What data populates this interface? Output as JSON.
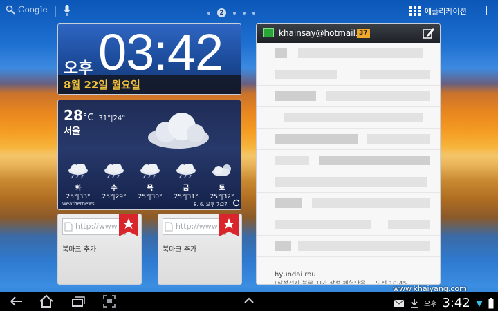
{
  "status_bar": {
    "search_label": "Google",
    "page_indicator": "2",
    "apps_label": "애플리케이션"
  },
  "clock": {
    "ampm": "오후",
    "time": "03:42",
    "date": "8월 22일 월요일"
  },
  "weather": {
    "temp": "28",
    "unit": "°C",
    "high_low": "31°|24°",
    "city": "서울",
    "forecast": [
      {
        "day": "화",
        "temp": "25°|33°"
      },
      {
        "day": "수",
        "temp": "25°|29°"
      },
      {
        "day": "목",
        "temp": "25°|30°"
      },
      {
        "day": "금",
        "temp": "25°|31°"
      },
      {
        "day": "토",
        "temp": "25°|32°"
      }
    ],
    "brand": "weathernews",
    "updated": "8. 6. 오후 7:27"
  },
  "bookmarks": [
    {
      "url": "http://www",
      "label": "북마크 추가"
    },
    {
      "url": "http://www",
      "label": "북마크 추가"
    }
  ],
  "email": {
    "account": "khainsay@hotmail...",
    "unread": "37",
    "last_sender": "hyundai rou",
    "last_preview": "[삼성전자 블로그]가 삼성 체험단을 ... 오전 10:45"
  },
  "system_bar": {
    "ampm": "오후",
    "time": "3:42",
    "watermark": "www.khaiyang.com"
  },
  "colors": {
    "clock_date": "#f2c23a",
    "email_badge": "#f0a82a",
    "bookmark_ribbon": "#d9262c"
  }
}
